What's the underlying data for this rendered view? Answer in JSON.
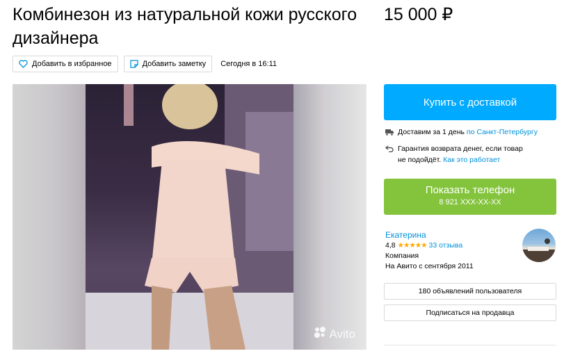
{
  "listing": {
    "title": "Комбинезон из натуральной кожи русского дизайнера",
    "price": "15 000 ₽"
  },
  "actions": {
    "favorite_label": "Добавить в избранное",
    "note_label": "Добавить заметку",
    "date": "Сегодня в 16:11"
  },
  "photo": {
    "watermark": "Avito"
  },
  "purchase": {
    "buy_label": "Купить с доставкой",
    "delivery_text": "Доставим за 1 день",
    "delivery_link": "по Санкт-Петербургу",
    "guarantee_text_1": "Гарантия возврата денег, если товар",
    "guarantee_text_2": "не подойдёт.",
    "guarantee_link": "Как это работает",
    "phone_label": "Показать телефон",
    "phone_number": "8 921 XXX-XX-XX"
  },
  "seller": {
    "name": "Екатерина",
    "rating": "4,8",
    "stars": "★★★★★",
    "reviews": "33 отзыва",
    "type": "Компания",
    "since": "На Авито с сентября 2011",
    "listings_button": "180 объявлений пользователя",
    "subscribe_button": "Подписаться на продавца"
  },
  "colors": {
    "buy_button": "#00aaff",
    "phone_button": "#84c43d",
    "link": "#0091d9",
    "stars": "#ffa800"
  }
}
